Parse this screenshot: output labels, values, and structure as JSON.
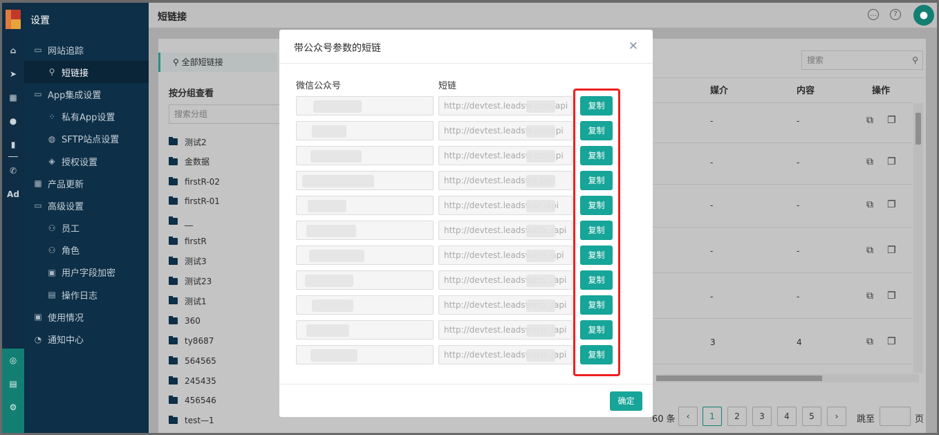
{
  "sidebar": {
    "title": "设置",
    "items": [
      {
        "label": "网站追踪",
        "icon": "folder-icon",
        "sub": false,
        "active": false
      },
      {
        "label": "短链接",
        "icon": "link-icon",
        "sub": true,
        "active": true
      },
      {
        "label": "App集成设置",
        "icon": "folder-icon",
        "sub": false,
        "active": false
      },
      {
        "label": "私有App设置",
        "icon": "app-grid-icon",
        "sub": true,
        "active": false
      },
      {
        "label": "SFTP站点设置",
        "icon": "globe-icon",
        "sub": true,
        "active": false
      },
      {
        "label": "授权设置",
        "icon": "shield-icon",
        "sub": true,
        "active": false
      },
      {
        "label": "产品更新",
        "icon": "grid-icon",
        "sub": false,
        "active": false
      },
      {
        "label": "高级设置",
        "icon": "folder-icon",
        "sub": false,
        "active": false
      },
      {
        "label": "员工",
        "icon": "user-icon",
        "sub": true,
        "active": false
      },
      {
        "label": "角色",
        "icon": "role-icon",
        "sub": true,
        "active": false
      },
      {
        "label": "用户字段加密",
        "icon": "lock-doc-icon",
        "sub": true,
        "active": false
      },
      {
        "label": "操作日志",
        "icon": "log-icon",
        "sub": true,
        "active": false
      },
      {
        "label": "使用情况",
        "icon": "usage-icon",
        "sub": false,
        "active": false
      },
      {
        "label": "通知中心",
        "icon": "bell-icon",
        "sub": false,
        "active": false
      }
    ]
  },
  "rail": {
    "icons": [
      "home-icon",
      "send-icon",
      "layout-icon",
      "user-icon",
      "bar-chart-icon",
      "wechat-icon"
    ],
    "ad_label": "Ad",
    "bottom_icons": [
      "contacts-icon",
      "server-icon",
      "gear-icon"
    ]
  },
  "header": {
    "title": "短链接",
    "icons": [
      "chat-icon",
      "help-icon",
      "avatar-icon"
    ]
  },
  "background": {
    "tag_label": "全部短链接",
    "group_title": "按分组查看",
    "group_search_placeholder": "搜索分组",
    "folders": [
      "测试2",
      "金数据",
      "firstR-02",
      "firstR-01",
      "__",
      "firstR",
      "测试3",
      "测试23",
      "测试1",
      "360",
      "ty8687",
      "564565",
      "245435",
      "456546",
      "test—1"
    ],
    "search_placeholder": "搜索",
    "columns": [
      "媒介",
      "内容",
      "操作"
    ],
    "rows": [
      {
        "media": "-",
        "content": "-"
      },
      {
        "media": "-",
        "content": "-"
      },
      {
        "media": "-",
        "content": "-"
      },
      {
        "media": "-",
        "content": "-"
      },
      {
        "media": "-",
        "content": "-"
      },
      {
        "media": "3",
        "content": "4"
      }
    ],
    "pagination": {
      "total_suffix": "60 条",
      "pages": [
        "1",
        "2",
        "3",
        "4",
        "5"
      ],
      "current": "1",
      "jump_label": "跳至",
      "page_suffix": "页"
    }
  },
  "modal": {
    "title": "带公众号参数的短链",
    "col_account": "微信公众号",
    "col_link": "短链",
    "copy_label": "复制",
    "ok_label": "确定",
    "rows": [
      {
        "link": "http://devtest.leadsw      com/api"
      },
      {
        "link": "http://devtest.leadsw      om/api"
      },
      {
        "link": "http://devtest.leadsw      om/api"
      },
      {
        "link": "http://devtest.leadswa      /api"
      },
      {
        "link": "http://devtest.leadswar      /api"
      },
      {
        "link": "http://devtest.leadswarp.      /api"
      },
      {
        "link": "http://devtest.leadswarp      /api"
      },
      {
        "link": "http://devtest.leadswarp.      /api"
      },
      {
        "link": "http://devtest.leadswarp.      /api"
      },
      {
        "link": "http://devtest.leadswarp.      /api"
      },
      {
        "link": "http://devtest.leadswarp.      /api"
      }
    ]
  }
}
